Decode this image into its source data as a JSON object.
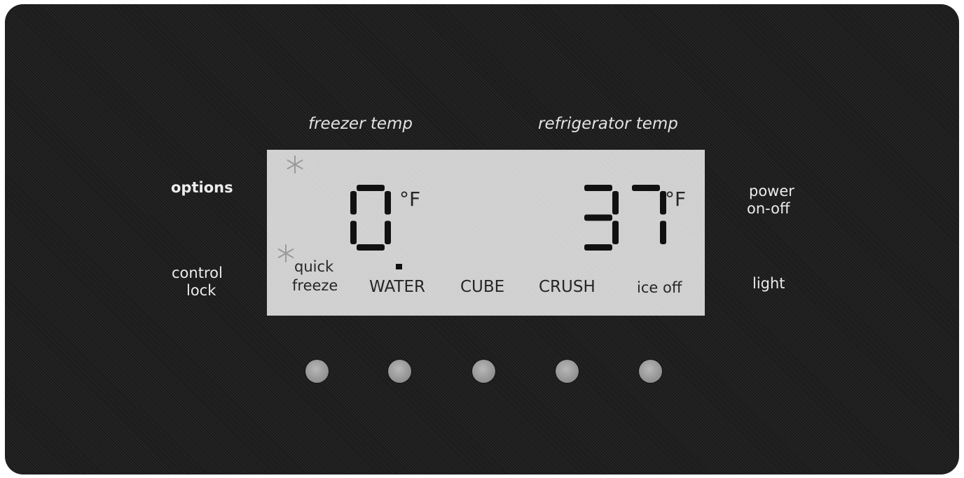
{
  "headings": {
    "freezer": "freezer temp",
    "refrigerator": "refrigerator temp"
  },
  "side_labels": {
    "options": "options",
    "control": "control",
    "lock": "lock",
    "power": "power",
    "on_off": "on-off",
    "light": "light"
  },
  "display": {
    "freezer_temp": "0",
    "freezer_unit": "°F",
    "refrigerator_temp": "37",
    "refrigerator_unit": "°F",
    "quick_line1": "quick",
    "quick_line2": "freeze",
    "modes": [
      "WATER",
      "CUBE",
      "CRUSH"
    ],
    "ice_off": "ice off",
    "active_mode": "WATER"
  },
  "icons": [
    "snowflake-icon",
    "snowflake-icon"
  ],
  "buttons": 5,
  "colors": {
    "panel": "#1a1a1a",
    "lcd": "#d4d4d4",
    "segment": "#111111",
    "button": "#9e9e9e"
  }
}
